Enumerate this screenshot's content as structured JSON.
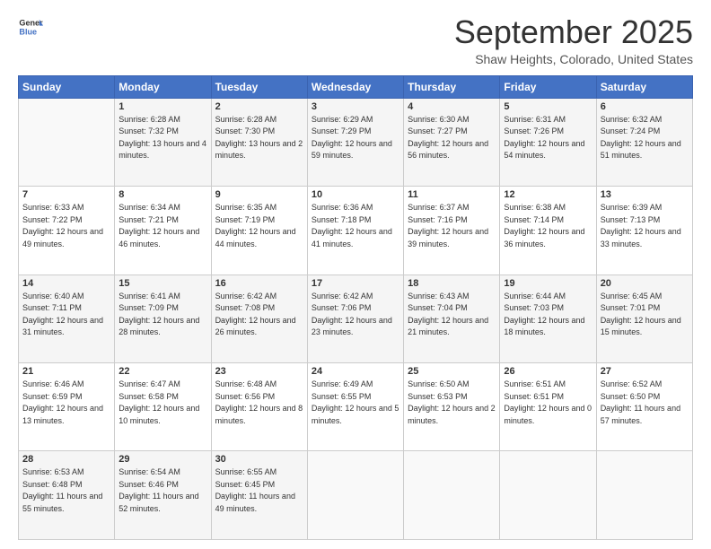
{
  "logo": {
    "line1": "General",
    "line2": "Blue"
  },
  "header": {
    "month": "September 2025",
    "location": "Shaw Heights, Colorado, United States"
  },
  "weekdays": [
    "Sunday",
    "Monday",
    "Tuesday",
    "Wednesday",
    "Thursday",
    "Friday",
    "Saturday"
  ],
  "weeks": [
    [
      {
        "day": "",
        "sunrise": "",
        "sunset": "",
        "daylight": ""
      },
      {
        "day": "1",
        "sunrise": "Sunrise: 6:28 AM",
        "sunset": "Sunset: 7:32 PM",
        "daylight": "Daylight: 13 hours and 4 minutes."
      },
      {
        "day": "2",
        "sunrise": "Sunrise: 6:28 AM",
        "sunset": "Sunset: 7:30 PM",
        "daylight": "Daylight: 13 hours and 2 minutes."
      },
      {
        "day": "3",
        "sunrise": "Sunrise: 6:29 AM",
        "sunset": "Sunset: 7:29 PM",
        "daylight": "Daylight: 12 hours and 59 minutes."
      },
      {
        "day": "4",
        "sunrise": "Sunrise: 6:30 AM",
        "sunset": "Sunset: 7:27 PM",
        "daylight": "Daylight: 12 hours and 56 minutes."
      },
      {
        "day": "5",
        "sunrise": "Sunrise: 6:31 AM",
        "sunset": "Sunset: 7:26 PM",
        "daylight": "Daylight: 12 hours and 54 minutes."
      },
      {
        "day": "6",
        "sunrise": "Sunrise: 6:32 AM",
        "sunset": "Sunset: 7:24 PM",
        "daylight": "Daylight: 12 hours and 51 minutes."
      }
    ],
    [
      {
        "day": "7",
        "sunrise": "Sunrise: 6:33 AM",
        "sunset": "Sunset: 7:22 PM",
        "daylight": "Daylight: 12 hours and 49 minutes."
      },
      {
        "day": "8",
        "sunrise": "Sunrise: 6:34 AM",
        "sunset": "Sunset: 7:21 PM",
        "daylight": "Daylight: 12 hours and 46 minutes."
      },
      {
        "day": "9",
        "sunrise": "Sunrise: 6:35 AM",
        "sunset": "Sunset: 7:19 PM",
        "daylight": "Daylight: 12 hours and 44 minutes."
      },
      {
        "day": "10",
        "sunrise": "Sunrise: 6:36 AM",
        "sunset": "Sunset: 7:18 PM",
        "daylight": "Daylight: 12 hours and 41 minutes."
      },
      {
        "day": "11",
        "sunrise": "Sunrise: 6:37 AM",
        "sunset": "Sunset: 7:16 PM",
        "daylight": "Daylight: 12 hours and 39 minutes."
      },
      {
        "day": "12",
        "sunrise": "Sunrise: 6:38 AM",
        "sunset": "Sunset: 7:14 PM",
        "daylight": "Daylight: 12 hours and 36 minutes."
      },
      {
        "day": "13",
        "sunrise": "Sunrise: 6:39 AM",
        "sunset": "Sunset: 7:13 PM",
        "daylight": "Daylight: 12 hours and 33 minutes."
      }
    ],
    [
      {
        "day": "14",
        "sunrise": "Sunrise: 6:40 AM",
        "sunset": "Sunset: 7:11 PM",
        "daylight": "Daylight: 12 hours and 31 minutes."
      },
      {
        "day": "15",
        "sunrise": "Sunrise: 6:41 AM",
        "sunset": "Sunset: 7:09 PM",
        "daylight": "Daylight: 12 hours and 28 minutes."
      },
      {
        "day": "16",
        "sunrise": "Sunrise: 6:42 AM",
        "sunset": "Sunset: 7:08 PM",
        "daylight": "Daylight: 12 hours and 26 minutes."
      },
      {
        "day": "17",
        "sunrise": "Sunrise: 6:42 AM",
        "sunset": "Sunset: 7:06 PM",
        "daylight": "Daylight: 12 hours and 23 minutes."
      },
      {
        "day": "18",
        "sunrise": "Sunrise: 6:43 AM",
        "sunset": "Sunset: 7:04 PM",
        "daylight": "Daylight: 12 hours and 21 minutes."
      },
      {
        "day": "19",
        "sunrise": "Sunrise: 6:44 AM",
        "sunset": "Sunset: 7:03 PM",
        "daylight": "Daylight: 12 hours and 18 minutes."
      },
      {
        "day": "20",
        "sunrise": "Sunrise: 6:45 AM",
        "sunset": "Sunset: 7:01 PM",
        "daylight": "Daylight: 12 hours and 15 minutes."
      }
    ],
    [
      {
        "day": "21",
        "sunrise": "Sunrise: 6:46 AM",
        "sunset": "Sunset: 6:59 PM",
        "daylight": "Daylight: 12 hours and 13 minutes."
      },
      {
        "day": "22",
        "sunrise": "Sunrise: 6:47 AM",
        "sunset": "Sunset: 6:58 PM",
        "daylight": "Daylight: 12 hours and 10 minutes."
      },
      {
        "day": "23",
        "sunrise": "Sunrise: 6:48 AM",
        "sunset": "Sunset: 6:56 PM",
        "daylight": "Daylight: 12 hours and 8 minutes."
      },
      {
        "day": "24",
        "sunrise": "Sunrise: 6:49 AM",
        "sunset": "Sunset: 6:55 PM",
        "daylight": "Daylight: 12 hours and 5 minutes."
      },
      {
        "day": "25",
        "sunrise": "Sunrise: 6:50 AM",
        "sunset": "Sunset: 6:53 PM",
        "daylight": "Daylight: 12 hours and 2 minutes."
      },
      {
        "day": "26",
        "sunrise": "Sunrise: 6:51 AM",
        "sunset": "Sunset: 6:51 PM",
        "daylight": "Daylight: 12 hours and 0 minutes."
      },
      {
        "day": "27",
        "sunrise": "Sunrise: 6:52 AM",
        "sunset": "Sunset: 6:50 PM",
        "daylight": "Daylight: 11 hours and 57 minutes."
      }
    ],
    [
      {
        "day": "28",
        "sunrise": "Sunrise: 6:53 AM",
        "sunset": "Sunset: 6:48 PM",
        "daylight": "Daylight: 11 hours and 55 minutes."
      },
      {
        "day": "29",
        "sunrise": "Sunrise: 6:54 AM",
        "sunset": "Sunset: 6:46 PM",
        "daylight": "Daylight: 11 hours and 52 minutes."
      },
      {
        "day": "30",
        "sunrise": "Sunrise: 6:55 AM",
        "sunset": "Sunset: 6:45 PM",
        "daylight": "Daylight: 11 hours and 49 minutes."
      },
      {
        "day": "",
        "sunrise": "",
        "sunset": "",
        "daylight": ""
      },
      {
        "day": "",
        "sunrise": "",
        "sunset": "",
        "daylight": ""
      },
      {
        "day": "",
        "sunrise": "",
        "sunset": "",
        "daylight": ""
      },
      {
        "day": "",
        "sunrise": "",
        "sunset": "",
        "daylight": ""
      }
    ]
  ]
}
